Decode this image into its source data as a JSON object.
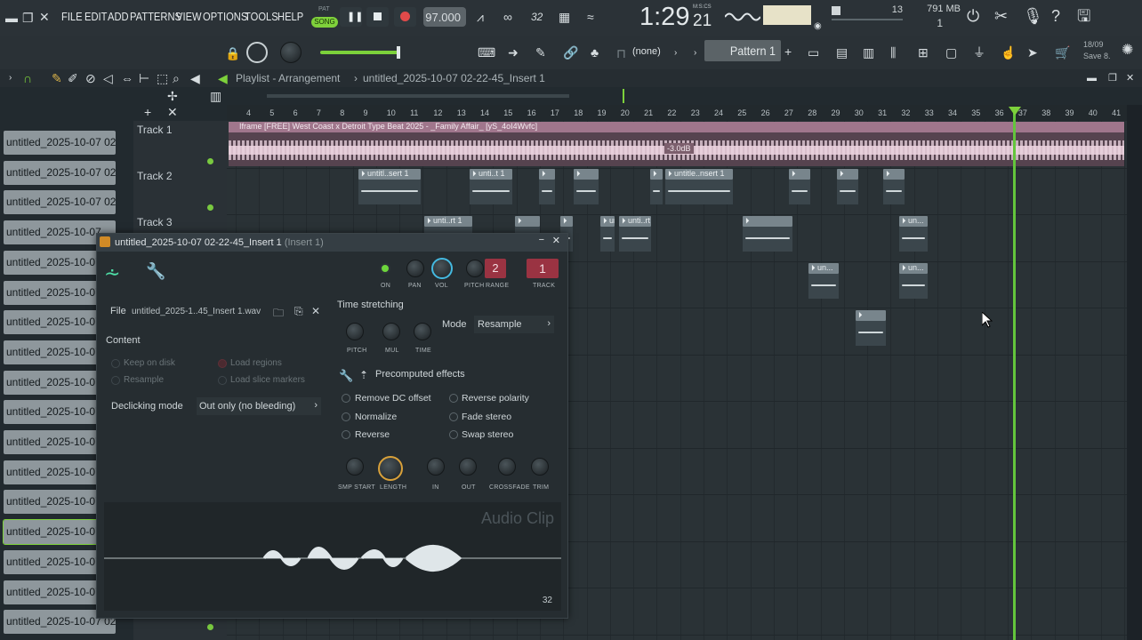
{
  "menu": [
    "FILE",
    "EDIT",
    "ADD",
    "PATTERNS",
    "VIEW",
    "OPTIONS",
    "TOOLS",
    "HELP"
  ],
  "transport": {
    "pat_label": "PAT",
    "song_label": "SONG",
    "tempo": "97.000",
    "time": "1:29",
    "time_sub": "21",
    "time_mode": "M:S:CS"
  },
  "monitor": {
    "cpu": "13",
    "mem": "791 MB",
    "poly": "1"
  },
  "toolbar2": {
    "pattern_select": "(none)",
    "pattern_name": "Pattern 1",
    "hint_date": "18/09",
    "hint_text": "Save 8."
  },
  "playlist": {
    "title": "Playlist - Arrangement",
    "sep": "›",
    "project": "untitled_2025-10-07 02-22-45_Insert 1"
  },
  "ruler_ticks": [
    "4",
    "5",
    "6",
    "7",
    "8",
    "9",
    "10",
    "11",
    "12",
    "13",
    "14",
    "15",
    "16",
    "17",
    "18",
    "19",
    "20",
    "21",
    "22",
    "23",
    "24",
    "25",
    "26",
    "27",
    "28",
    "29",
    "30",
    "31",
    "32",
    "33",
    "34",
    "35",
    "36",
    "37",
    "38",
    "39",
    "40",
    "41"
  ],
  "tracks": [
    "Track 1",
    "Track 2",
    "Track 3"
  ],
  "browser_items": [
    "untitled_2025-10-07 02-...",
    "untitled_2025-10-07 02-...",
    "untitled_2025-10-07 02-...",
    "untitled_2025-10-07",
    "untitled_2025-10-07",
    "untitled_2025-10-07",
    "untitled_2025-10-07",
    "untitled_2025-10-07",
    "untitled_2025-10-07",
    "untitled_2025-10-07",
    "untitled_2025-10-07",
    "untitled_2025-10-07",
    "untitled_2025-10-07",
    "untitled_2025-10-07",
    "untitled_2025-10-07",
    "untitled_2025-10-07",
    "untitled_2025-10-07 02-..."
  ],
  "main_clip": {
    "label": "Iframe [FREE] West Coast x Detroit Type Beat 2025 - _Family Affair_ [yS_4oI4Wvfc]",
    "gain": "-3.0dB"
  },
  "clips": [
    "untitl..sert 1",
    "unti..t 1",
    "",
    "",
    "",
    "untitle..nsert 1",
    "",
    "",
    "",
    "unti..rt 1",
    "",
    "",
    "un...",
    "unti..rt 1",
    "",
    "un...",
    "un...",
    "un..."
  ],
  "panel": {
    "title": "untitled_2025-10-07 02-22-45_Insert 1",
    "title_sub": "(Insert 1)",
    "knobs": {
      "on": "ON",
      "pan": "PAN",
      "vol": "VOL",
      "pitch": "PITCH",
      "range": "RANGE",
      "track": "TRACK",
      "range_val": "2",
      "track_val": "1"
    },
    "file_label": "File",
    "file_name": "untitled_2025-1..45_Insert 1.wav",
    "content_label": "Content",
    "keep_on_disk": "Keep on disk",
    "load_regions": "Load regions",
    "resample": "Resample",
    "load_slice": "Load slice markers",
    "declicking_label": "Declicking mode",
    "declicking_value": "Out only (no bleeding)",
    "time_stretching": "Time stretching",
    "ts_knobs": [
      "PITCH",
      "MUL",
      "TIME"
    ],
    "mode_label": "Mode",
    "mode_value": "Resample",
    "precomputed": "Precomputed effects",
    "effects": [
      "Remove DC offset",
      "Normalize",
      "Reverse",
      "Reverse polarity",
      "Fade stereo",
      "Swap stereo"
    ],
    "bottom_knobs": [
      "SMP START",
      "LENGTH",
      "IN",
      "OUT",
      "CROSSFADE",
      "TRIM"
    ],
    "watermark": "Audio Clip",
    "zoom": "32"
  }
}
